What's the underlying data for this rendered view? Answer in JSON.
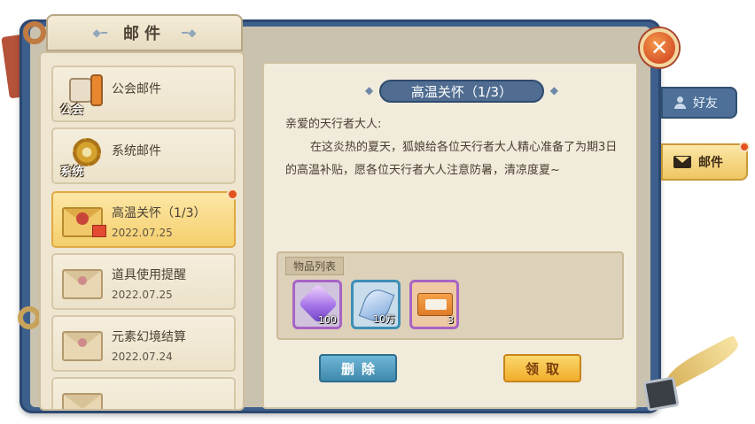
{
  "window": {
    "title": "邮件"
  },
  "mail_list": [
    {
      "title": "公会邮件",
      "date": "",
      "icon": "guild-horn-icon",
      "icon_caption": "公会",
      "selected": false,
      "unread": false
    },
    {
      "title": "系统邮件",
      "date": "",
      "icon": "system-gear-icon",
      "icon_caption": "系统",
      "selected": false,
      "unread": false
    },
    {
      "title": "高温关怀（1/3）",
      "date": "2022.07.25",
      "icon": "gift-envelope-icon",
      "icon_caption": "",
      "selected": true,
      "unread": true
    },
    {
      "title": "道具使用提醒",
      "date": "2022.07.25",
      "icon": "envelope-icon",
      "icon_caption": "",
      "selected": false,
      "unread": false
    },
    {
      "title": "元素幻境结算",
      "date": "2022.07.24",
      "icon": "envelope-icon",
      "icon_caption": "",
      "selected": false,
      "unread": false
    }
  ],
  "detail": {
    "title": "高温关怀（1/3）",
    "greeting": "亲爱的天行者大人:",
    "body": "在这炎热的夏天，狐娘给各位天行者大人精心准备了为期3日的高温补贴，愿各位天行者大人注意防暑，清凉度夏~",
    "items_label": "物品列表",
    "rewards": [
      {
        "icon": "crystal-icon",
        "quantity": "100",
        "rarity": "purple"
      },
      {
        "icon": "leaf-icon",
        "quantity": "10万",
        "rarity": "blue"
      },
      {
        "icon": "ticket-icon",
        "quantity": "3",
        "rarity": "purple"
      }
    ],
    "delete_label": "删除",
    "claim_label": "领取"
  },
  "side_tabs": [
    {
      "label": "好友",
      "icon": "person-icon",
      "active": false
    },
    {
      "label": "邮件",
      "icon": "envelope-icon",
      "active": true
    }
  ],
  "colors": {
    "frame": "#3d5f8c",
    "parchment": "#f1ebdc",
    "selected": "#f5cf6d",
    "unread_dot": "#e2531f",
    "delete_button": "#3f89ad",
    "claim_button": "#f1ad2c"
  }
}
